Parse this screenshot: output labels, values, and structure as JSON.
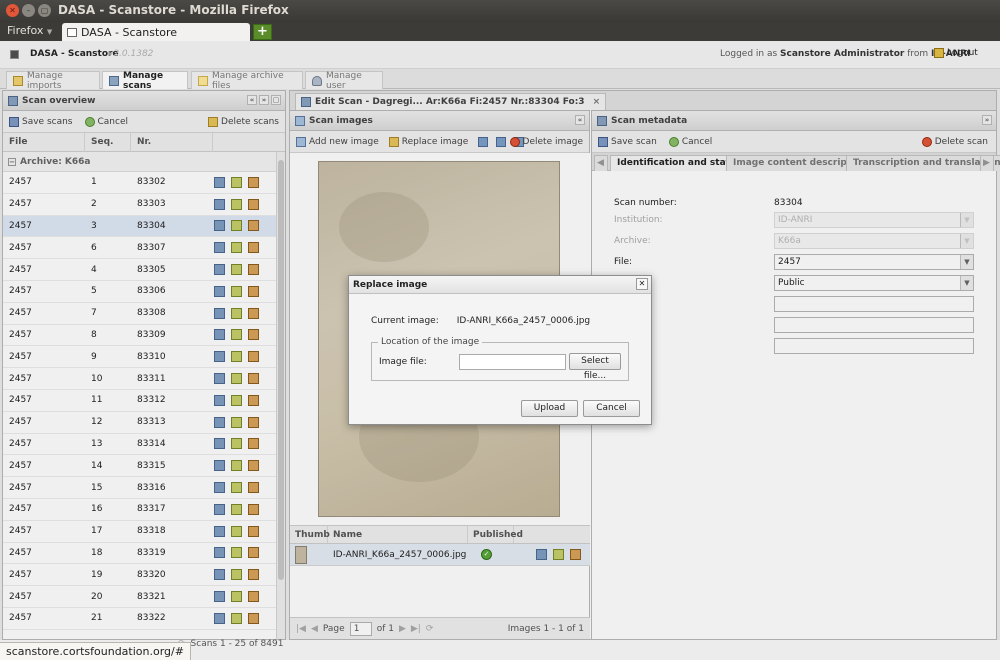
{
  "window": {
    "title": "DASA - Scanstore - Mozilla Firefox"
  },
  "browser": {
    "menu_label": "Firefox",
    "tab_title": "DASA - Scanstore",
    "new_tab_label": "+"
  },
  "app": {
    "name": "DASA - Scanstore",
    "version": "v2.0.1382",
    "login_prefix": "Logged in as",
    "user": "Scanstore Administrator",
    "login_mid": "from",
    "org": "ID-ANRI",
    "logout": "Logout"
  },
  "nav": {
    "tabs": [
      {
        "label": "Manage imports",
        "icon": "box-icon"
      },
      {
        "label": "Manage scans",
        "icon": "scanner-icon"
      },
      {
        "label": "Manage archive files",
        "icon": "folder-icon"
      },
      {
        "label": "Manage user",
        "icon": "users-icon"
      }
    ]
  },
  "overview": {
    "title": "Scan overview",
    "save": "Save scans",
    "cancel": "Cancel",
    "delete": "Delete scans",
    "columns": [
      "File",
      "Seq.",
      "Nr."
    ],
    "group": "Archive: K66a",
    "rows": [
      [
        "2457",
        "1",
        "83302"
      ],
      [
        "2457",
        "2",
        "83303"
      ],
      [
        "2457",
        "3",
        "83304"
      ],
      [
        "2457",
        "6",
        "83307"
      ],
      [
        "2457",
        "4",
        "83305"
      ],
      [
        "2457",
        "5",
        "83306"
      ],
      [
        "2457",
        "7",
        "83308"
      ],
      [
        "2457",
        "8",
        "83309"
      ],
      [
        "2457",
        "9",
        "83310"
      ],
      [
        "2457",
        "10",
        "83311"
      ],
      [
        "2457",
        "11",
        "83312"
      ],
      [
        "2457",
        "12",
        "83313"
      ],
      [
        "2457",
        "13",
        "83314"
      ],
      [
        "2457",
        "14",
        "83315"
      ],
      [
        "2457",
        "15",
        "83316"
      ],
      [
        "2457",
        "16",
        "83317"
      ],
      [
        "2457",
        "17",
        "83318"
      ],
      [
        "2457",
        "18",
        "83319"
      ],
      [
        "2457",
        "19",
        "83320"
      ],
      [
        "2457",
        "20",
        "83321"
      ],
      [
        "2457",
        "21",
        "83322"
      ]
    ],
    "selected_index": 2,
    "pager_text": "Scans 1 - 25 of 8491"
  },
  "edit_tab": {
    "title": "Edit Scan - Dagregi... Ar:K66a Fi:2457 Nr.:83304 Fo:3"
  },
  "images": {
    "title": "Scan images",
    "add": "Add new image",
    "replace": "Replace image",
    "delete": "Delete image",
    "columns": [
      "Thumb",
      "Name",
      "Published"
    ],
    "row": {
      "name": "ID-ANRI_K66a_2457_0006.jpg",
      "published": true
    },
    "pager": {
      "page_label": "Page",
      "page": "1",
      "of": "of 1",
      "count": "Images 1 - 1 of 1"
    }
  },
  "metadata": {
    "title": "Scan metadata",
    "save": "Save scan",
    "cancel": "Cancel",
    "delete": "Delete scan",
    "tabs": [
      "Identification and status",
      "Image content descriptive",
      "Transcription and translation"
    ],
    "fields": [
      {
        "label": "Scan number:",
        "value": "83304"
      },
      {
        "label": "Institution:",
        "value": "ID-ANRI"
      },
      {
        "label": "Archive:",
        "value": "K66a"
      },
      {
        "label": "File:",
        "value": "2457"
      },
      {
        "label": "",
        "value": "Public"
      }
    ]
  },
  "dialog": {
    "title": "Replace image",
    "current_label": "Current image:",
    "current_value": "ID-ANRI_K66a_2457_0006.jpg",
    "legend": "Location of the image",
    "file_label": "Image file:",
    "select": "Select file...",
    "upload": "Upload",
    "cancel": "Cancel"
  },
  "status": {
    "url": "scanstore.cortsfoundation.org/#"
  }
}
